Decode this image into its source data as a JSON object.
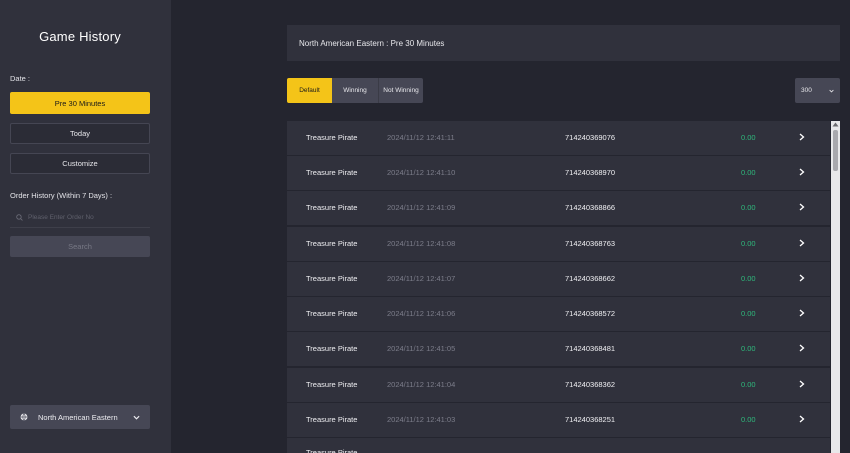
{
  "sidebar": {
    "title": "Game History",
    "date_label": "Date :",
    "date_options": [
      {
        "label": "Pre 30 Minutes",
        "active": true
      },
      {
        "label": "Today",
        "active": false
      },
      {
        "label": "Customize",
        "active": false
      }
    ],
    "order_history_label": "Order History (Within 7 Days) :",
    "search_placeholder": "Please Enter Order No",
    "search_button": "Search",
    "region": "North American Eastern"
  },
  "header": {
    "title": "North American Eastern : Pre 30 Minutes"
  },
  "tabs": [
    {
      "label": "Default",
      "active": true
    },
    {
      "label": "Winning",
      "active": false
    },
    {
      "label": "Not Winning",
      "active": false
    }
  ],
  "count_select": {
    "value": "300"
  },
  "rows": [
    {
      "game": "Treasure Pirate",
      "time": "2024/11/12 12:41:11",
      "order": "714240369076",
      "amount": "0.00"
    },
    {
      "game": "Treasure Pirate",
      "time": "2024/11/12 12:41:10",
      "order": "714240368970",
      "amount": "0.00"
    },
    {
      "game": "Treasure Pirate",
      "time": "2024/11/12 12:41:09",
      "order": "714240368866",
      "amount": "0.00"
    },
    {
      "game": "Treasure Pirate",
      "time": "2024/11/12 12:41:08",
      "order": "714240368763",
      "amount": "0.00"
    },
    {
      "game": "Treasure Pirate",
      "time": "2024/11/12 12:41:07",
      "order": "714240368662",
      "amount": "0.00"
    },
    {
      "game": "Treasure Pirate",
      "time": "2024/11/12 12:41:06",
      "order": "714240368572",
      "amount": "0.00"
    },
    {
      "game": "Treasure Pirate",
      "time": "2024/11/12 12:41:05",
      "order": "714240368481",
      "amount": "0.00"
    },
    {
      "game": "Treasure Pirate",
      "time": "2024/11/12 12:41:04",
      "order": "714240368362",
      "amount": "0.00"
    },
    {
      "game": "Treasure Pirate",
      "time": "2024/11/12 12:41:03",
      "order": "714240368251",
      "amount": "0.00"
    },
    {
      "game": "Treasure Pirate",
      "time": "",
      "order": "",
      "amount": ""
    }
  ],
  "colors": {
    "accent": "#f4c418",
    "win_amount": "#2fb87c",
    "panel": "#30313c",
    "background": "#24252f"
  },
  "icons": {
    "search": "search-icon",
    "globe": "globe-icon",
    "chevron_down": "chevron-down-icon",
    "row_arrow": "chevron-right-icon",
    "scroll_up": "scroll-up-arrow-icon"
  }
}
